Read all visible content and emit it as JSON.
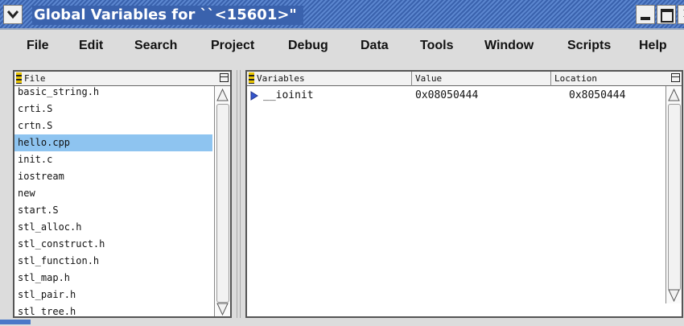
{
  "window": {
    "title": "Global Variables for ``<15601>\"",
    "close_glyph": "✕"
  },
  "menu": [
    "File",
    "Edit",
    "Search",
    "Project",
    "Debug",
    "Data",
    "Tools",
    "Window",
    "Scripts",
    "Help"
  ],
  "file_pane": {
    "header": "File",
    "files": [
      "basic_string.h",
      "crti.S",
      "crtn.S",
      "hello.cpp",
      "init.c",
      "iostream",
      "new",
      "start.S",
      "stl_alloc.h",
      "stl_construct.h",
      "stl_function.h",
      "stl_map.h",
      "stl_pair.h",
      "stl_tree.h"
    ],
    "selected_index": 3
  },
  "variables_pane": {
    "headers": {
      "variables": "Variables",
      "value": "Value",
      "location": "Location"
    },
    "rows": [
      {
        "name": "__ioinit",
        "value": "0x08050444",
        "location": "0x8050444"
      }
    ]
  },
  "colors": {
    "title_bar": "#3a62ad",
    "selection": "#8ec4f0",
    "header_marker": "#e8c400"
  }
}
